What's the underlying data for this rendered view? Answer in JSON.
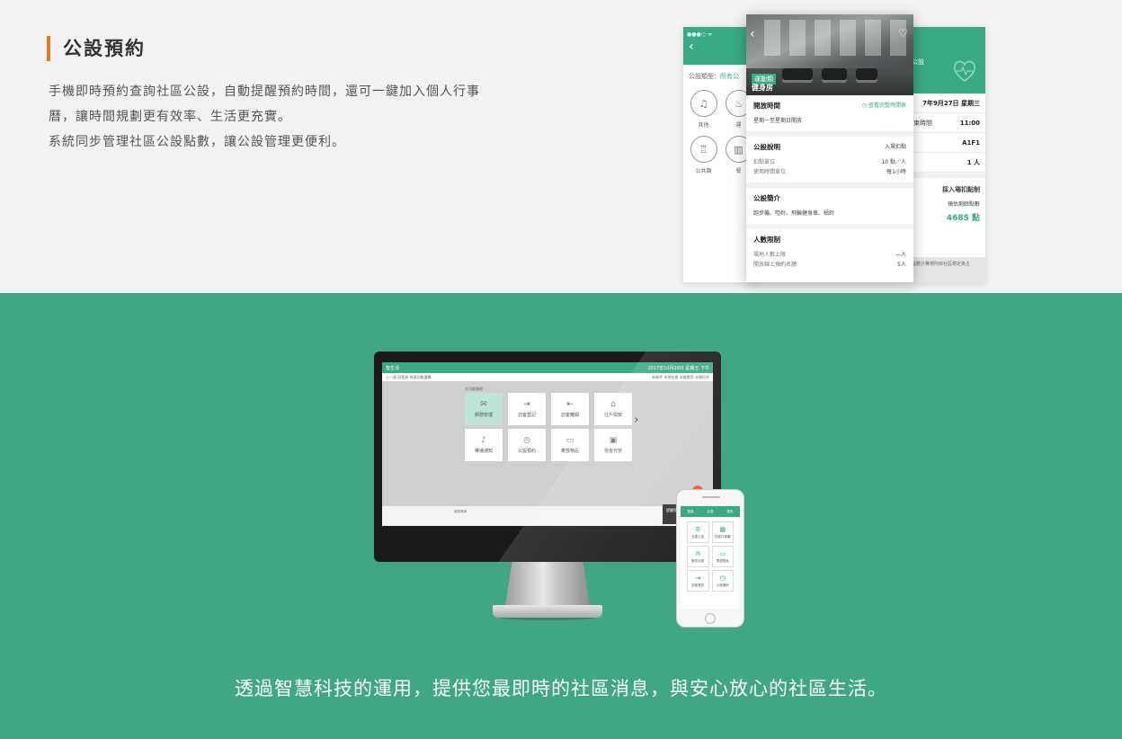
{
  "section": {
    "title": "公設預約",
    "desc_lines": [
      "手機即時預約查詢社區公設，自動提醒預約時間，還可一鍵加入個人行事",
      "曆，讓時間規劃更有效率、生活更充實。",
      "系統同步管理社區公設點數，讓公設管理更便利。"
    ]
  },
  "phone_left": {
    "type_label": "公設類型：",
    "type_value": "所有公",
    "categories": [
      {
        "label": "其他",
        "icon": "headphones-icon"
      },
      {
        "label": "運",
        "icon": "run-icon"
      },
      {
        "label": "公共類",
        "icon": "sofa-icon"
      },
      {
        "label": "餐",
        "icon": "book-icon"
      }
    ]
  },
  "phone_right": {
    "header": "公設",
    "rows": [
      {
        "label": "",
        "value": "7年9月27日 星期三"
      },
      {
        "label": "束時間",
        "value": "11:00"
      },
      {
        "label": "",
        "value": "A1F1"
      },
      {
        "label": "",
        "value": "1 人"
      }
    ],
    "points_title": "採入場扣點制",
    "points_label": "預估剩餘點數",
    "points_value": "4685 點",
    "footer": "點數計費規則依社區規定為主"
  },
  "phone_main": {
    "badge": "運動類",
    "name": "健身房",
    "open_title": "開放時間",
    "open_link": "查看完整時間表",
    "open_value": "星期一至星期日開放",
    "desc_title": "公設說明",
    "desc_right": "入場扣點",
    "desc_lines": [
      {
        "label": "扣點單位",
        "value": "10 點／人"
      },
      {
        "label": "使用時間單位",
        "value": "每1小時"
      }
    ],
    "intro_title": "公設簡介",
    "intro_value": "跑步機、啞鈴、飛輪健身車、槓鈴",
    "limit_title": "人數限制",
    "limit_lines": [
      {
        "label": "場地人數上限",
        "value": "—人"
      },
      {
        "label": "開放線上預約名額",
        "value": "5人"
      }
    ]
  },
  "desktop": {
    "header_left": "智生活",
    "header_right": "2017年10月26日 星期五 下午",
    "sub_left": "上一頁  回首頁  快速功能選單",
    "sub_right": "新郵件  未領包裹  未繳費用  未讀訊息",
    "section_label": "主功能服務",
    "tiles": [
      {
        "label": "郵務管理",
        "glyph": "✉",
        "active": true
      },
      {
        "label": "訪客登記",
        "glyph": "⇥",
        "active": false
      },
      {
        "label": "訪客離開",
        "glyph": "⇤",
        "active": false
      },
      {
        "label": "住戶開鎖",
        "glyph": "⌂",
        "active": false
      },
      {
        "label": "推播通知",
        "glyph": "♪",
        "active": false
      },
      {
        "label": "公設預約",
        "glyph": "◷",
        "active": false
      },
      {
        "label": "寄放物品",
        "glyph": "▭",
        "active": false
      },
      {
        "label": "現金代管",
        "glyph": "▣",
        "active": false
      }
    ],
    "footer": "客服專線",
    "popup": "提醒您"
  },
  "mobile": {
    "tabs": [
      "首頁",
      "社區",
      "更多"
    ],
    "tiles": [
      {
        "label": "社區公告",
        "glyph": "☰"
      },
      {
        "label": "社區行事曆",
        "glyph": "▦"
      },
      {
        "label": "郵件包裹",
        "glyph": "✉"
      },
      {
        "label": "寄放物品",
        "glyph": "▭"
      },
      {
        "label": "訪客登記",
        "glyph": "⇥"
      },
      {
        "label": "公設預約",
        "glyph": "◷"
      }
    ]
  },
  "slogan": "透過智慧科技的運用，提供您最即時的社區消息，與安心放心的社區生活。"
}
